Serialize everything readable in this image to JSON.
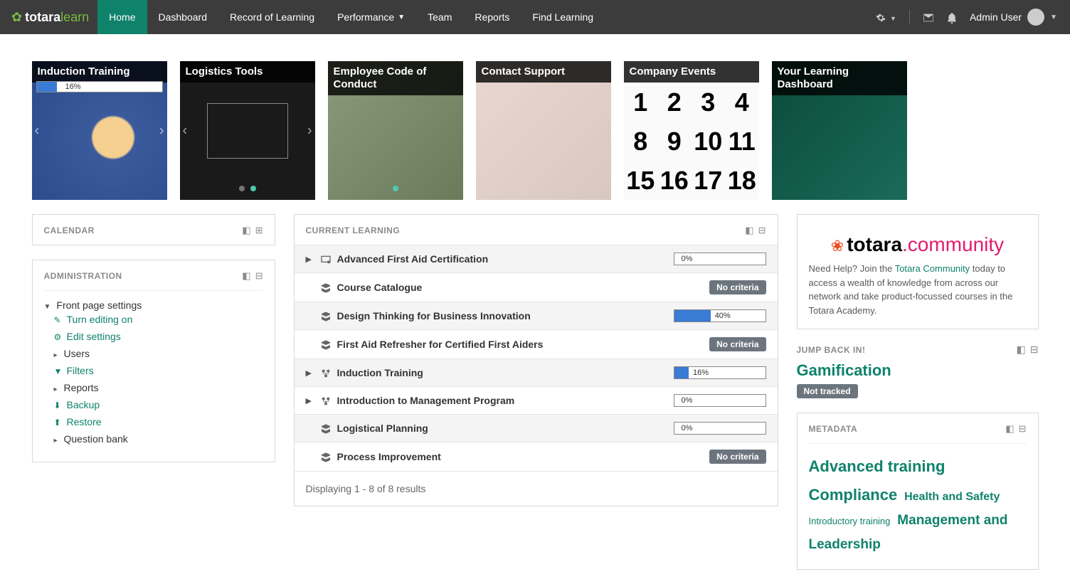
{
  "brand": {
    "t1": "totara",
    "t2": "learn"
  },
  "nav": {
    "items": [
      {
        "label": "Home",
        "active": true
      },
      {
        "label": "Dashboard"
      },
      {
        "label": "Record of Learning"
      },
      {
        "label": "Performance",
        "dropdown": true
      },
      {
        "label": "Team"
      },
      {
        "label": "Reports"
      },
      {
        "label": "Find Learning"
      }
    ],
    "user": "Admin User"
  },
  "tiles": [
    {
      "title": "Induction Training",
      "progress": 16,
      "bg": "linear-gradient(135deg,#2a4a8c,#1a3a6c)",
      "arrows": true
    },
    {
      "title": "Logistics Tools",
      "bg": "#1a1a1a",
      "arrows": true,
      "dots": 2
    },
    {
      "title": "Employee Code of Conduct",
      "bg": "linear-gradient(135deg,#8a9a7a,#6a7a5a)",
      "dots": 1
    },
    {
      "title": "Contact Support",
      "bg": "linear-gradient(135deg,#e8d8d0,#d8c8c0)"
    },
    {
      "title": "Company Events",
      "bg": "#f0f0f0"
    },
    {
      "title": "Your Learning Dashboard",
      "bg": "linear-gradient(135deg,#0a4a3a,#1a6a5a)"
    }
  ],
  "calendar": {
    "title": "CALENDAR"
  },
  "admin": {
    "title": "ADMINISTRATION",
    "root": "Front page settings",
    "items": [
      {
        "label": "Turn editing on",
        "icon": "edit",
        "link": true
      },
      {
        "label": "Edit settings",
        "icon": "gear",
        "link": true
      },
      {
        "label": "Users",
        "icon": "caret",
        "link": false
      },
      {
        "label": "Filters",
        "icon": "filter",
        "link": true
      },
      {
        "label": "Reports",
        "icon": "caret",
        "link": false
      },
      {
        "label": "Backup",
        "icon": "download",
        "link": true
      },
      {
        "label": "Restore",
        "icon": "upload",
        "link": true
      },
      {
        "label": "Question bank",
        "icon": "caret",
        "link": false
      }
    ]
  },
  "current": {
    "title": "CURRENT LEARNING",
    "rows": [
      {
        "name": "Advanced First Aid Certification",
        "expand": true,
        "type": "cert",
        "progress": 0
      },
      {
        "name": "Course Catalogue",
        "type": "course",
        "nocriteria": true
      },
      {
        "name": "Design Thinking for Business Innovation",
        "type": "course",
        "progress": 40
      },
      {
        "name": "First Aid Refresher for Certified First Aiders",
        "type": "course",
        "nocriteria": true
      },
      {
        "name": "Induction Training",
        "expand": true,
        "type": "program",
        "progress": 16
      },
      {
        "name": "Introduction to Management Program",
        "expand": true,
        "type": "program",
        "progress": 0
      },
      {
        "name": "Logistical Planning",
        "type": "course",
        "progress": 0
      },
      {
        "name": "Process Improvement",
        "type": "course",
        "nocriteria": true
      }
    ],
    "footer": "Displaying 1 - 8 of 8 results",
    "nocriteria_label": "No criteria"
  },
  "community": {
    "logo1": "totara",
    "logo2": ".community",
    "text_pre": "Need Help? Join the ",
    "link": "Totara Community",
    "text_post": " today to access a wealth of knowledge from across our network and take product-focussed courses in the Totara Academy."
  },
  "jump": {
    "title": "JUMP BACK IN!",
    "item": "Gamification",
    "badge": "Not tracked"
  },
  "metadata": {
    "title": "METADATA",
    "tags": [
      {
        "label": "Advanced training",
        "size": "lg"
      },
      {
        "label": "Compliance",
        "size": "lg"
      },
      {
        "label": "Health and Safety",
        "size": "md"
      },
      {
        "label": "Introductory training",
        "size": "sm"
      },
      {
        "label": "Management and Leadership",
        "size": "xl"
      }
    ]
  }
}
